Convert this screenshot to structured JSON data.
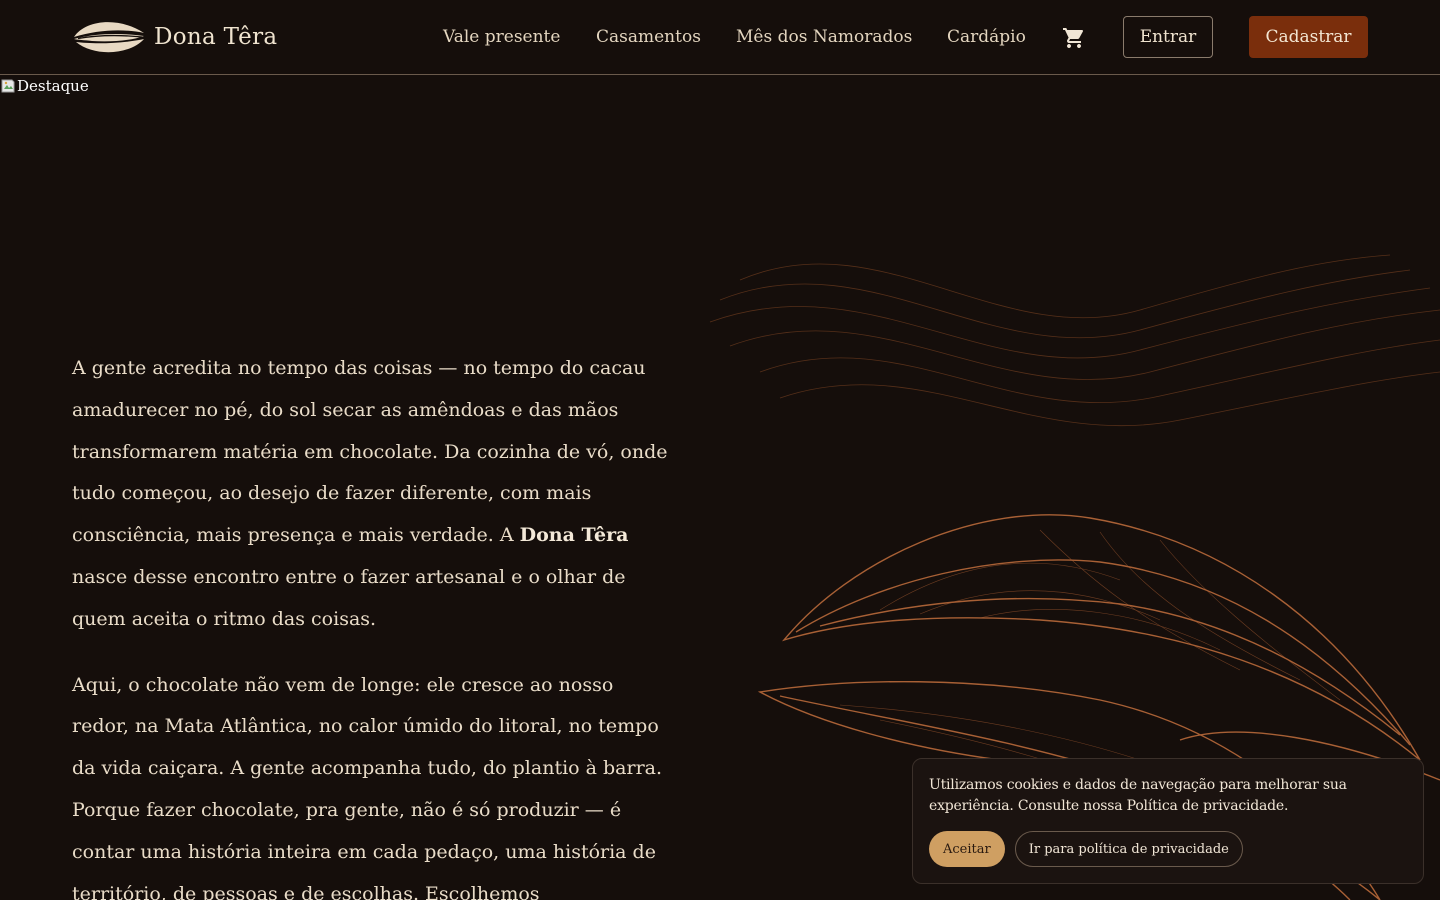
{
  "header": {
    "brand": {
      "name": "Dona Têra",
      "logo_icon": "cacao-pod-logo-icon"
    },
    "nav": [
      {
        "label": "Vale presente"
      },
      {
        "label": "Casamentos"
      },
      {
        "label": "Mês dos Namorados"
      },
      {
        "label": "Cardápio"
      }
    ],
    "cart_icon": "cart-icon",
    "login_label": "Entrar",
    "signup_label": "Cadastrar"
  },
  "hero": {
    "image_alt": "Destaque"
  },
  "content": {
    "paragraph1": {
      "before": "A gente acredita no tempo das coisas — no tempo do cacau amadurecer no pé, do sol secar as amêndoas e das mãos transformarem matéria em chocolate. Da cozinha de vó, onde tudo começou, ao desejo de fazer diferente, com mais consciência, mais presença e mais verdade. A ",
      "highlight": "Dona Têra",
      "after": " nasce desse encontro entre o fazer artesanal e o olhar de quem aceita o ritmo das coisas."
    },
    "paragraph2": "Aqui, o chocolate não vem de longe: ele cresce ao nosso redor, na Mata Atlântica, no calor úmido do litoral, no tempo da vida caiçara. A gente acompanha tudo, do plantio à barra. Porque fazer chocolate, pra gente, não é só produzir — é contar uma história inteira em cada pedaço, uma história de território, de pessoas e de escolhas. Escolhemos"
  },
  "cookie_banner": {
    "message": "Utilizamos cookies e dados de navegação para melhorar sua experiência. Consulte nossa Política de privacidade.",
    "accept_label": "Aceitar",
    "policy_label": "Ir para política de privacidade"
  },
  "colors": {
    "background": "#150e0b",
    "text": "#e9dcc8",
    "accent_button": "#7a2e0c",
    "cookie_accept": "#cf9f62",
    "line_art": "#b8693a"
  }
}
